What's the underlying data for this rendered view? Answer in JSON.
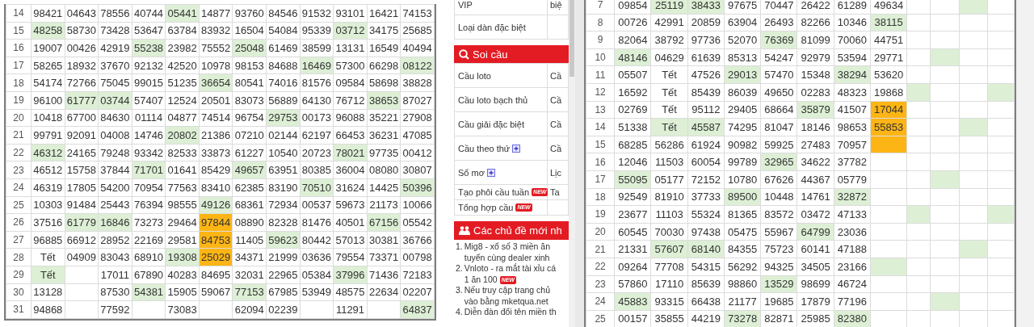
{
  "left_table": {
    "rows": [
      {
        "day": "14",
        "cells": [
          {
            "text": "98421"
          },
          {
            "text": "04643"
          },
          {
            "text": "78556"
          },
          {
            "text": "40744"
          },
          {
            "text": "05441",
            "color": "#ddefd5"
          },
          {
            "text": "14877"
          },
          {
            "text": "93760"
          },
          {
            "text": "84546"
          },
          {
            "text": "91532"
          },
          {
            "text": "93101"
          },
          {
            "text": "16421"
          },
          {
            "text": "74153"
          }
        ]
      },
      {
        "day": "15",
        "cells": [
          {
            "text": "48258",
            "color": "#ddefd5"
          },
          {
            "text": "58730"
          },
          {
            "text": "73428"
          },
          {
            "text": "53647"
          },
          {
            "text": "63784"
          },
          {
            "text": "83932"
          },
          {
            "text": "16504"
          },
          {
            "text": "54084"
          },
          {
            "text": "95339"
          },
          {
            "text": "03712",
            "color": "#ddefd5"
          },
          {
            "text": "34175"
          },
          {
            "text": "25685"
          }
        ]
      },
      {
        "day": "16",
        "cells": [
          {
            "text": "19007"
          },
          {
            "text": "00426"
          },
          {
            "text": "42919"
          },
          {
            "text": "55238",
            "color": "#ddefd5"
          },
          {
            "text": "23982"
          },
          {
            "text": "75552"
          },
          {
            "text": "25048",
            "color": "#ddefd5"
          },
          {
            "text": "61469"
          },
          {
            "text": "38599"
          },
          {
            "text": "13131"
          },
          {
            "text": "16549"
          },
          {
            "text": "40494"
          }
        ]
      },
      {
        "day": "17",
        "cells": [
          {
            "text": "58265"
          },
          {
            "text": "18932"
          },
          {
            "text": "37670"
          },
          {
            "text": "92132"
          },
          {
            "text": "42520"
          },
          {
            "text": "10978"
          },
          {
            "text": "98153"
          },
          {
            "text": "84688"
          },
          {
            "text": "16469",
            "color": "#ddefd5"
          },
          {
            "text": "57300"
          },
          {
            "text": "66298"
          },
          {
            "text": "08122",
            "color": "#ddefd5"
          }
        ]
      },
      {
        "day": "18",
        "cells": [
          {
            "text": "54174"
          },
          {
            "text": "72766"
          },
          {
            "text": "75045"
          },
          {
            "text": "99015"
          },
          {
            "text": "51235"
          },
          {
            "text": "36654",
            "color": "#ddefd5"
          },
          {
            "text": "80541"
          },
          {
            "text": "74016"
          },
          {
            "text": "81576"
          },
          {
            "text": "09584"
          },
          {
            "text": "58698"
          },
          {
            "text": "38828"
          }
        ]
      },
      {
        "day": "19",
        "cells": [
          {
            "text": "96100"
          },
          {
            "text": "61777",
            "color": "#ddefd5"
          },
          {
            "text": "03744",
            "color": "#ddefd5"
          },
          {
            "text": "57407"
          },
          {
            "text": "12524"
          },
          {
            "text": "20501"
          },
          {
            "text": "83073"
          },
          {
            "text": "56889"
          },
          {
            "text": "64130"
          },
          {
            "text": "76712"
          },
          {
            "text": "38653",
            "color": "#ddefd5"
          },
          {
            "text": "87027"
          }
        ]
      },
      {
        "day": "20",
        "cells": [
          {
            "text": "10418"
          },
          {
            "text": "67700"
          },
          {
            "text": "84630"
          },
          {
            "text": "01114"
          },
          {
            "text": "04877"
          },
          {
            "text": "74514"
          },
          {
            "text": "96754"
          },
          {
            "text": "29753",
            "color": "#ddefd5"
          },
          {
            "text": "00173"
          },
          {
            "text": "96088"
          },
          {
            "text": "35221"
          },
          {
            "text": "27908"
          }
        ]
      },
      {
        "day": "21",
        "cells": [
          {
            "text": "99791"
          },
          {
            "text": "92091"
          },
          {
            "text": "04008"
          },
          {
            "text": "14746"
          },
          {
            "text": "20802",
            "color": "#ddefd5"
          },
          {
            "text": "21386"
          },
          {
            "text": "07210"
          },
          {
            "text": "02144"
          },
          {
            "text": "62197"
          },
          {
            "text": "66453"
          },
          {
            "text": "36231"
          },
          {
            "text": "47085"
          }
        ]
      },
      {
        "day": "22",
        "cells": [
          {
            "text": "46312",
            "color": "#ddefd5"
          },
          {
            "text": "24165"
          },
          {
            "text": "79248"
          },
          {
            "text": "93342"
          },
          {
            "text": "82533"
          },
          {
            "text": "33873"
          },
          {
            "text": "61227"
          },
          {
            "text": "10540"
          },
          {
            "text": "20723"
          },
          {
            "text": "78021",
            "color": "#ddefd5"
          },
          {
            "text": "97735"
          },
          {
            "text": "00412"
          }
        ]
      },
      {
        "day": "23",
        "cells": [
          {
            "text": "46512"
          },
          {
            "text": "15758"
          },
          {
            "text": "37844"
          },
          {
            "text": "71701",
            "color": "#ddefd5"
          },
          {
            "text": "01641"
          },
          {
            "text": "85429"
          },
          {
            "text": "49657",
            "color": "#ddefd5"
          },
          {
            "text": "63951"
          },
          {
            "text": "80385"
          },
          {
            "text": "36004"
          },
          {
            "text": "08080"
          },
          {
            "text": "30807"
          }
        ]
      },
      {
        "day": "24",
        "cells": [
          {
            "text": "46319"
          },
          {
            "text": "17805"
          },
          {
            "text": "54200"
          },
          {
            "text": "70954"
          },
          {
            "text": "77563"
          },
          {
            "text": "83410"
          },
          {
            "text": "62385"
          },
          {
            "text": "83190"
          },
          {
            "text": "70510",
            "color": "#ddefd5"
          },
          {
            "text": "31624"
          },
          {
            "text": "14425"
          },
          {
            "text": "50396",
            "color": "#ddefd5"
          }
        ]
      },
      {
        "day": "25",
        "cells": [
          {
            "text": "10303"
          },
          {
            "text": "91484"
          },
          {
            "text": "25443"
          },
          {
            "text": "76394"
          },
          {
            "text": "98555"
          },
          {
            "text": "49126",
            "color": "#ddefd5"
          },
          {
            "text": "68361"
          },
          {
            "text": "72934"
          },
          {
            "text": "00537"
          },
          {
            "text": "59673"
          },
          {
            "text": "21173"
          },
          {
            "text": "10066"
          }
        ]
      },
      {
        "day": "26",
        "cells": [
          {
            "text": "37516"
          },
          {
            "text": "61779",
            "color": "#ddefd5"
          },
          {
            "text": "16846",
            "color": "#ddefd5"
          },
          {
            "text": "73273"
          },
          {
            "text": "29464"
          },
          {
            "text": "97844",
            "color": "#fdb515"
          },
          {
            "text": "08890"
          },
          {
            "text": "82328"
          },
          {
            "text": "81476"
          },
          {
            "text": "40501"
          },
          {
            "text": "67156",
            "color": "#ddefd5"
          },
          {
            "text": "05542"
          }
        ]
      },
      {
        "day": "27",
        "cells": [
          {
            "text": "96885"
          },
          {
            "text": "66912"
          },
          {
            "text": "28952"
          },
          {
            "text": "22169"
          },
          {
            "text": "29581"
          },
          {
            "text": "84753",
            "color": "#fdb515"
          },
          {
            "text": "11405"
          },
          {
            "text": "59623",
            "color": "#ddefd5"
          },
          {
            "text": "80442"
          },
          {
            "text": "57013"
          },
          {
            "text": "30381"
          },
          {
            "text": "36766"
          }
        ]
      },
      {
        "day": "28",
        "cells": [
          {
            "text": "Tết"
          },
          {
            "text": "04909"
          },
          {
            "text": "83043"
          },
          {
            "text": "68910"
          },
          {
            "text": "19308",
            "color": "#ddefd5"
          },
          {
            "text": "25029",
            "color": "#fdb515"
          },
          {
            "text": "34371"
          },
          {
            "text": "21999"
          },
          {
            "text": "03636"
          },
          {
            "text": "79554"
          },
          {
            "text": "73371"
          },
          {
            "text": "00798"
          }
        ]
      },
      {
        "day": "29",
        "cells": [
          {
            "text": "Tết",
            "color": "#ddefd5"
          },
          {},
          {
            "text": "17011"
          },
          {
            "text": "67890"
          },
          {
            "text": "40283"
          },
          {
            "text": "84695"
          },
          {
            "text": "32031"
          },
          {
            "text": "22965"
          },
          {
            "text": "05384"
          },
          {
            "text": "37996",
            "color": "#ddefd5"
          },
          {
            "text": "71436"
          },
          {
            "text": "72183"
          }
        ]
      },
      {
        "day": "30",
        "cells": [
          {
            "text": "13128"
          },
          {},
          {
            "text": "87530"
          },
          {
            "text": "54381",
            "color": "#ddefd5"
          },
          {
            "text": "15905"
          },
          {
            "text": "59067"
          },
          {
            "text": "77153",
            "color": "#ddefd5"
          },
          {
            "text": "67985"
          },
          {
            "text": "53949"
          },
          {
            "text": "48575"
          },
          {
            "text": "22634"
          },
          {
            "text": "02207"
          }
        ]
      },
      {
        "day": "31",
        "cells": [
          {
            "text": "94868"
          },
          {},
          {
            "text": "77592"
          },
          {},
          {
            "text": "73083"
          },
          {},
          {
            "text": "62094"
          },
          {
            "text": "02239"
          },
          {},
          {
            "text": "11291"
          },
          {},
          {
            "text": "64837",
            "color": "#ddefd5"
          }
        ]
      }
    ]
  },
  "side_panel": {
    "top_rows": [
      {
        "label": "VIP",
        "value": "biệ"
      },
      {
        "label": "Loại dàn đặc biệt"
      }
    ],
    "soi_cau": {
      "title": "Soi cầu",
      "rows": [
        {
          "label": "Cầu loto",
          "value": "Cầ",
          "expandable": false
        },
        {
          "label": "Cầu loto bạch thủ",
          "value": "Cầ",
          "expandable": false
        },
        {
          "label": "Cầu giải đặc biệt",
          "value": "Cầ",
          "expandable": false
        },
        {
          "label": "Cầu theo thứ",
          "value": "Cầ",
          "expandable": true
        },
        {
          "label": "Sổ mơ",
          "value": "Lịc",
          "expandable": true
        },
        {
          "label": "Tạo phôi cầu tuần",
          "value": "Ta",
          "expandable": false,
          "badge": "NEW"
        },
        {
          "label": "Tổng hợp cầu",
          "expandable": false,
          "badge": "NEW"
        }
      ]
    },
    "topics": {
      "title": "Các chủ đề mới nh",
      "items": [
        {
          "number": "1.",
          "lines": [
            "Mig8 - xổ số 3 miền ăn",
            "tuyển cùng dealer xinh"
          ]
        },
        {
          "number": "2.",
          "lines": [
            "Vnloto - ra mắt tài xỉu cá",
            "1 ăn 100"
          ],
          "badge": "NEW"
        },
        {
          "number": "3.",
          "lines": [
            "Nếu truy cập trang chủ",
            "vào bằng mketqua.net"
          ]
        },
        {
          "number": "4.",
          "lines": [
            "Diễn đàn đổi tên miền th"
          ]
        }
      ]
    }
  },
  "right_table": {
    "rows": [
      {
        "day": "7",
        "cells": [
          {
            "text": "09854"
          },
          {
            "text": "25119",
            "color": "#ddefd5"
          },
          {
            "text": "38433",
            "color": "#ddefd5"
          },
          {
            "text": "97675"
          },
          {
            "text": "70447"
          },
          {
            "text": "26422"
          },
          {
            "text": "61289"
          },
          {
            "text": "49634"
          },
          {},
          {},
          {
            "color": "#ddefd5"
          },
          {}
        ]
      },
      {
        "day": "8",
        "cells": [
          {
            "text": "00726"
          },
          {
            "text": "42991"
          },
          {
            "text": "20859"
          },
          {
            "text": "63904"
          },
          {
            "text": "26493"
          },
          {
            "text": "82266"
          },
          {
            "text": "10346"
          },
          {
            "text": "38115",
            "color": "#ddefd5"
          },
          {},
          {},
          {},
          {}
        ]
      },
      {
        "day": "9",
        "cells": [
          {
            "text": "82064"
          },
          {
            "text": "38792"
          },
          {
            "text": "97736"
          },
          {
            "text": "52070"
          },
          {
            "text": "76369",
            "color": "#ddefd5"
          },
          {
            "text": "81099"
          },
          {
            "text": "70060"
          },
          {
            "text": "44751"
          },
          {},
          {},
          {},
          {}
        ]
      },
      {
        "day": "10",
        "cells": [
          {
            "text": "48146",
            "color": "#ddefd5"
          },
          {
            "text": "04629"
          },
          {
            "text": "61639"
          },
          {
            "text": "85313"
          },
          {
            "text": "54247"
          },
          {
            "text": "92979"
          },
          {
            "text": "53594"
          },
          {
            "text": "29771"
          },
          {},
          {
            "color": "#ddefd5"
          },
          {},
          {}
        ]
      },
      {
        "day": "11",
        "cells": [
          {
            "text": "05507"
          },
          {
            "text": "Tết"
          },
          {
            "text": "47526"
          },
          {
            "text": "29013",
            "color": "#ddefd5"
          },
          {
            "text": "57470"
          },
          {
            "text": "15348"
          },
          {
            "text": "38294",
            "color": "#ddefd5"
          },
          {
            "text": "53620"
          },
          {},
          {},
          {},
          {}
        ]
      },
      {
        "day": "12",
        "cells": [
          {
            "text": "16592"
          },
          {
            "text": "Tết"
          },
          {
            "text": "85439"
          },
          {
            "text": "86039"
          },
          {
            "text": "49650"
          },
          {
            "text": "02283"
          },
          {
            "text": "48323"
          },
          {
            "text": "19868"
          },
          {
            "color": "#ddefd5"
          },
          {},
          {},
          {
            "color": "#ddefd5"
          }
        ]
      },
      {
        "day": "13",
        "cells": [
          {
            "text": "02769"
          },
          {
            "text": "Tết"
          },
          {
            "text": "95112"
          },
          {
            "text": "29405"
          },
          {
            "text": "68664"
          },
          {
            "text": "35879",
            "color": "#ddefd5"
          },
          {
            "text": "41507"
          },
          {
            "text": "17044",
            "color": "#fdb515"
          },
          {},
          {},
          {},
          {}
        ]
      },
      {
        "day": "14",
        "cells": [
          {
            "text": "51338"
          },
          {
            "text": "Tết",
            "color": "#ddefd5"
          },
          {
            "text": "45587",
            "color": "#ddefd5"
          },
          {
            "text": "74295"
          },
          {
            "text": "81047"
          },
          {
            "text": "18146"
          },
          {
            "text": "98653"
          },
          {
            "text": "55853",
            "color": "#fdb515"
          },
          {},
          {},
          {
            "color": "#ddefd5"
          },
          {}
        ]
      },
      {
        "day": "15",
        "cells": [
          {
            "text": "68285"
          },
          {
            "text": "56286"
          },
          {
            "text": "61924"
          },
          {
            "text": "90982"
          },
          {
            "text": "59925"
          },
          {
            "text": "27483"
          },
          {
            "text": "70957"
          },
          {
            "color": "#fdb515"
          },
          {},
          {},
          {},
          {}
        ]
      },
      {
        "day": "16",
        "cells": [
          {
            "text": "12046"
          },
          {
            "text": "11503"
          },
          {
            "text": "60054"
          },
          {
            "text": "99789"
          },
          {
            "text": "32965",
            "color": "#ddefd5"
          },
          {
            "text": "34622"
          },
          {
            "text": "37782"
          },
          {},
          {},
          {},
          {},
          {}
        ]
      },
      {
        "day": "17",
        "cells": [
          {
            "text": "55095",
            "color": "#ddefd5"
          },
          {
            "text": "05177"
          },
          {
            "text": "72152"
          },
          {
            "text": "10780"
          },
          {
            "text": "67626"
          },
          {
            "text": "44367"
          },
          {
            "text": "05779"
          },
          {},
          {},
          {
            "color": "#ddefd5"
          },
          {},
          {}
        ]
      },
      {
        "day": "18",
        "cells": [
          {
            "text": "92549"
          },
          {
            "text": "81910"
          },
          {
            "text": "37733"
          },
          {
            "text": "89500",
            "color": "#ddefd5"
          },
          {
            "text": "10448"
          },
          {
            "text": "14761"
          },
          {
            "text": "32872",
            "color": "#ddefd5"
          },
          {},
          {},
          {},
          {},
          {}
        ]
      },
      {
        "day": "19",
        "cells": [
          {
            "text": "23677"
          },
          {
            "text": "11103"
          },
          {
            "text": "55324"
          },
          {
            "text": "81365"
          },
          {
            "text": "83572"
          },
          {
            "text": "03472"
          },
          {
            "text": "47133"
          },
          {},
          {
            "color": "#ddefd5"
          },
          {},
          {},
          {
            "color": "#ddefd5"
          }
        ]
      },
      {
        "day": "20",
        "cells": [
          {
            "text": "60545"
          },
          {
            "text": "70030"
          },
          {
            "text": "97438"
          },
          {
            "text": "05475"
          },
          {
            "text": "55967"
          },
          {
            "text": "64799",
            "color": "#ddefd5"
          },
          {
            "text": "23036"
          },
          {},
          {},
          {},
          {},
          {}
        ]
      },
      {
        "day": "21",
        "cells": [
          {
            "text": "21331"
          },
          {
            "text": "57607",
            "color": "#ddefd5"
          },
          {
            "text": "68140",
            "color": "#ddefd5"
          },
          {
            "text": "84355"
          },
          {
            "text": "75723"
          },
          {
            "text": "60141"
          },
          {
            "text": "47188"
          },
          {},
          {},
          {},
          {
            "color": "#ddefd5"
          },
          {}
        ]
      },
      {
        "day": "22",
        "cells": [
          {
            "text": "09264"
          },
          {
            "text": "77708"
          },
          {
            "text": "54315"
          },
          {
            "text": "56292"
          },
          {
            "text": "94325"
          },
          {
            "text": "34505"
          },
          {
            "text": "23166"
          },
          {
            "color": "#ddefd5"
          },
          {},
          {},
          {},
          {}
        ]
      },
      {
        "day": "23",
        "cells": [
          {
            "text": "57860"
          },
          {
            "text": "17110"
          },
          {
            "text": "85639"
          },
          {
            "text": "98860"
          },
          {
            "text": "13529",
            "color": "#ddefd5"
          },
          {
            "text": "98699"
          },
          {
            "text": "46724"
          },
          {},
          {},
          {},
          {},
          {}
        ]
      },
      {
        "day": "24",
        "cells": [
          {
            "text": "45883",
            "color": "#ddefd5"
          },
          {
            "text": "93315"
          },
          {
            "text": "66438"
          },
          {
            "text": "21177"
          },
          {
            "text": "19685"
          },
          {
            "text": "17879"
          },
          {
            "text": "77196"
          },
          {},
          {},
          {
            "color": "#ddefd5"
          },
          {},
          {}
        ]
      },
      {
        "day": "25",
        "cells": [
          {
            "text": "00157"
          },
          {
            "text": "35855"
          },
          {
            "text": "44219"
          },
          {
            "text": "73278",
            "color": "#ddefd5"
          },
          {
            "text": "82871"
          },
          {
            "text": "25985"
          },
          {
            "text": "82380",
            "color": "#ddefd5"
          },
          {},
          {},
          {},
          {},
          {}
        ]
      }
    ]
  }
}
